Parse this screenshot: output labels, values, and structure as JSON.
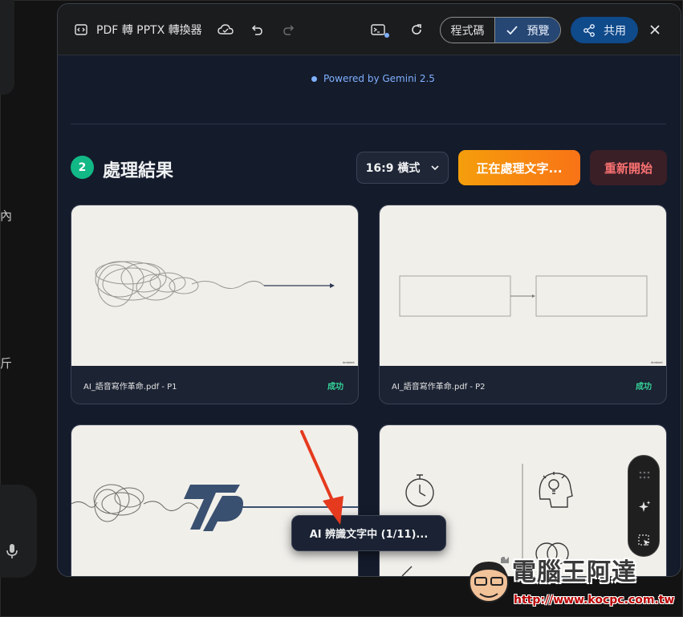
{
  "background": {
    "left_chars": [
      "內",
      "斤"
    ]
  },
  "toolbar": {
    "title": "PDF 轉 PPTX 轉換器",
    "code_label": "程式碼",
    "preview_label": "預覽",
    "share_label": "共用"
  },
  "powered_by": "Powered by Gemini 2.5",
  "section": {
    "step_number": "2",
    "title": "處理結果",
    "ratio_value": "16:9 橫式",
    "processing_label": "正在處理文字...",
    "restart_label": "重新開始"
  },
  "cards": [
    {
      "file": "AI_語音寫作革命.pdf - P1",
      "status": "成功"
    },
    {
      "file": "AI_語音寫作革命.pdf - P2",
      "status": "成功"
    },
    {
      "file": "",
      "status": ""
    },
    {
      "file": "",
      "status": ""
    }
  ],
  "toast": "AI 辨識文字中 (1/11)...",
  "watermark": {
    "name": "電腦王阿達",
    "url": "http://www.kocpc.com.tw"
  },
  "colors": {
    "accent_green": "#12b886",
    "accent_orange": "#f59e0b",
    "restart_red": "#f87171",
    "share_blue": "#0f4a8a",
    "arrow_red": "#e53a1e"
  }
}
